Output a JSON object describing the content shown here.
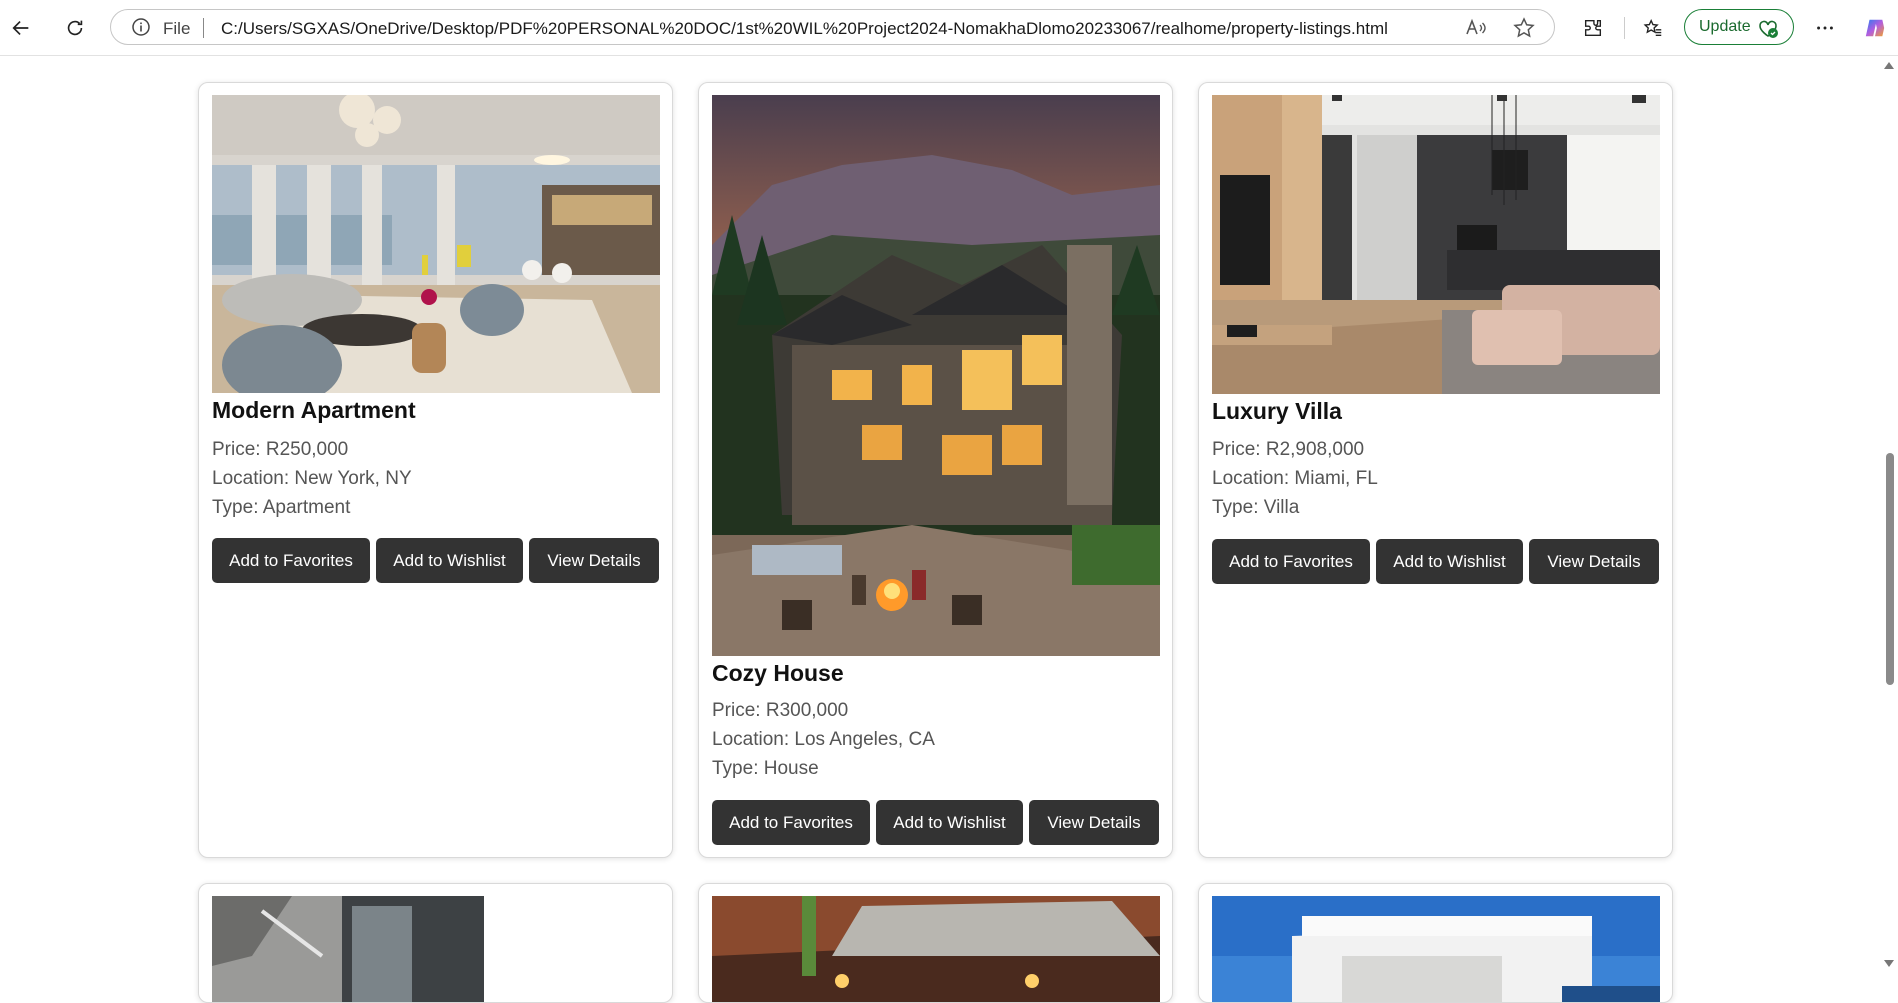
{
  "browser": {
    "file_label": "File",
    "url": "C:/Users/SGXAS/OneDrive/Desktop/PDF%20PERSONAL%20DOC/1st%20WIL%20Project2024-NomakhaDlomo20233067/realhome/property-listings.html",
    "update_label": "Update",
    "icons": [
      "back-icon",
      "refresh-icon",
      "info-icon",
      "read-aloud-icon",
      "favorite-star-icon",
      "extensions-icon",
      "favorites-icon",
      "more-icon",
      "copilot-icon"
    ]
  },
  "listings": [
    {
      "title": "Modern Apartment",
      "price": "Price: R250,000",
      "location": "Location: New York, NY",
      "type": "Type: Apartment",
      "buttons": {
        "favorites": "Add to Favorites",
        "wishlist": "Add to Wishlist",
        "details": "View Details"
      }
    },
    {
      "title": "Cozy House",
      "price": "Price: R300,000",
      "location": "Location: Los Angeles, CA",
      "type": "Type: House",
      "buttons": {
        "favorites": "Add to Favorites",
        "wishlist": "Add to Wishlist",
        "details": "View Details"
      }
    },
    {
      "title": "Luxury Villa",
      "price": "Price: R2,908,000",
      "location": "Location: Miami, FL",
      "type": "Type: Villa",
      "buttons": {
        "favorites": "Add to Favorites",
        "wishlist": "Add to Wishlist",
        "details": "View Details"
      }
    }
  ],
  "colors": {
    "button_bg": "#333333",
    "update_green": "#1a7f37"
  }
}
